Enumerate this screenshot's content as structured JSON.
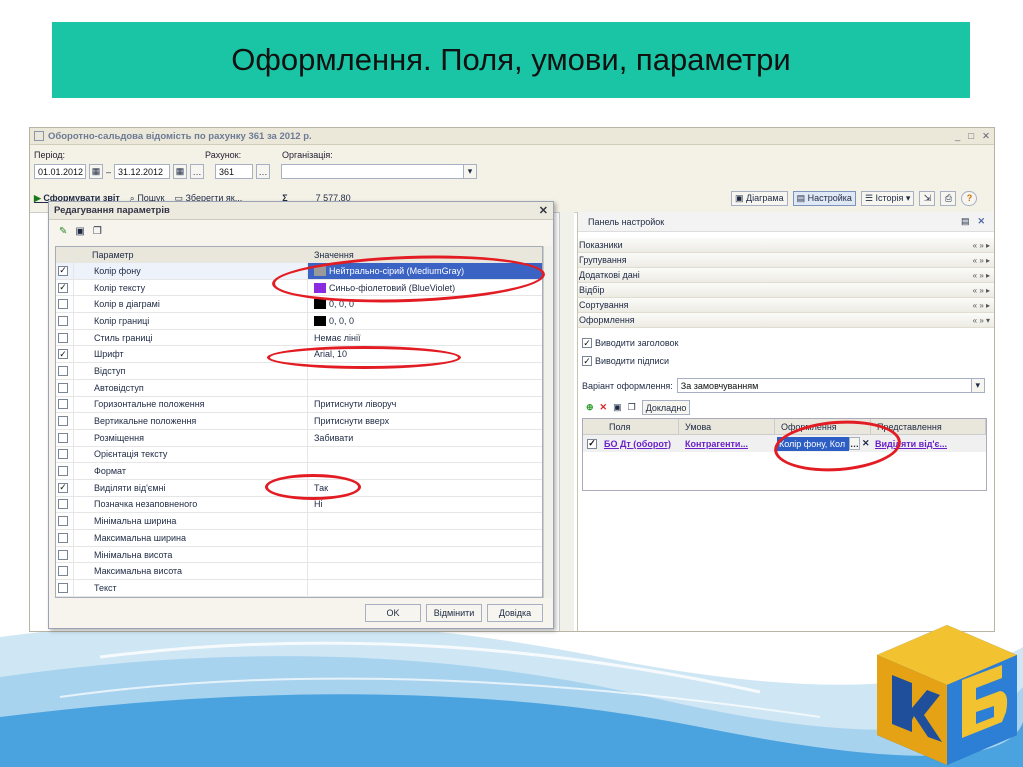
{
  "slide": {
    "title": "Оформлення. Поля, умови, параметри"
  },
  "window": {
    "title": "Оборотно-сальдова відомість по рахунку 361 за 2012 р.",
    "period_label": "Період:",
    "date_from": "01.01.2012",
    "date_to": "31.12.2012",
    "account_label": "Рахунок:",
    "account_value": "361",
    "org_label": "Організація:",
    "org_value": "",
    "toolbar": {
      "generate": "Сформувати звіт",
      "search": "Пошук",
      "save": "Зберегти як...",
      "sum_symbol": "Σ",
      "sum": "7 577,80",
      "chart": "Діаграма",
      "settings": "Настройка",
      "history": "Історія",
      "help": "?"
    }
  },
  "panel": {
    "title": "Панель настройок",
    "sections": [
      "Показники",
      "Групування",
      "Додаткові дані",
      "Відбір",
      "Сортування",
      "Оформлення"
    ],
    "show_header": "Виводити заголовок",
    "show_signatures": "Виводити підписи",
    "variant_label": "Варіант оформлення:",
    "variant_value": "За замовчуванням",
    "details": "Докладно",
    "table": {
      "headers": [
        "Поля",
        "Умова",
        "Оформлення",
        "Представлення"
      ],
      "row": {
        "field": "БО Дт (оборот)",
        "condition": "Контрагенти...",
        "design": "Колір фону, Кол",
        "representation": "Виділяти від'є..."
      }
    }
  },
  "dialog": {
    "title": "Редагування параметрів",
    "col_param": "Параметр",
    "col_value": "Значення",
    "rows": [
      {
        "param": "Колір фону",
        "value": "Нейтрально-сірий (MediumGray)",
        "checked": true,
        "swatch": "#9a9a9a"
      },
      {
        "param": "Колір тексту",
        "value": "Синьо-фіолетовий (BlueViolet)",
        "checked": true,
        "swatch": "#8a2be2"
      },
      {
        "param": "Колір в діаграмі",
        "value": "0, 0, 0",
        "checked": false,
        "swatch": "#000000"
      },
      {
        "param": "Колір границі",
        "value": "0, 0, 0",
        "checked": false,
        "swatch": "#000000"
      },
      {
        "param": "Стиль границі",
        "value": "Немає лінії",
        "checked": false
      },
      {
        "param": "Шрифт",
        "value": "Arial, 10",
        "checked": true
      },
      {
        "param": "Відступ",
        "value": "",
        "checked": false
      },
      {
        "param": "Автовідступ",
        "value": "",
        "checked": false
      },
      {
        "param": "Горизонтальне положення",
        "value": "Притиснути ліворуч",
        "checked": false
      },
      {
        "param": "Вертикальне положення",
        "value": "Притиснути вверх",
        "checked": false
      },
      {
        "param": "Розміщення",
        "value": "Забивати",
        "checked": false
      },
      {
        "param": "Орієнтація тексту",
        "value": "",
        "checked": false
      },
      {
        "param": "Формат",
        "value": "",
        "checked": false
      },
      {
        "param": "Виділяти від'ємні",
        "value": "Так",
        "checked": true
      },
      {
        "param": "Позначка незаповненого",
        "value": "Ні",
        "checked": false
      },
      {
        "param": "Мінімальна ширина",
        "value": "",
        "checked": false
      },
      {
        "param": "Максимальна ширина",
        "value": "",
        "checked": false
      },
      {
        "param": "Мінімальна висота",
        "value": "",
        "checked": false
      },
      {
        "param": "Максимальна висота",
        "value": "",
        "checked": false
      },
      {
        "param": "Текст",
        "value": "",
        "checked": false
      }
    ],
    "ok": "OK",
    "cancel": "Відмінити",
    "help": "Довідка"
  },
  "colors": {
    "banner": "#19c5a4",
    "highlight": "#e21c22",
    "link": "#6a20c8"
  }
}
